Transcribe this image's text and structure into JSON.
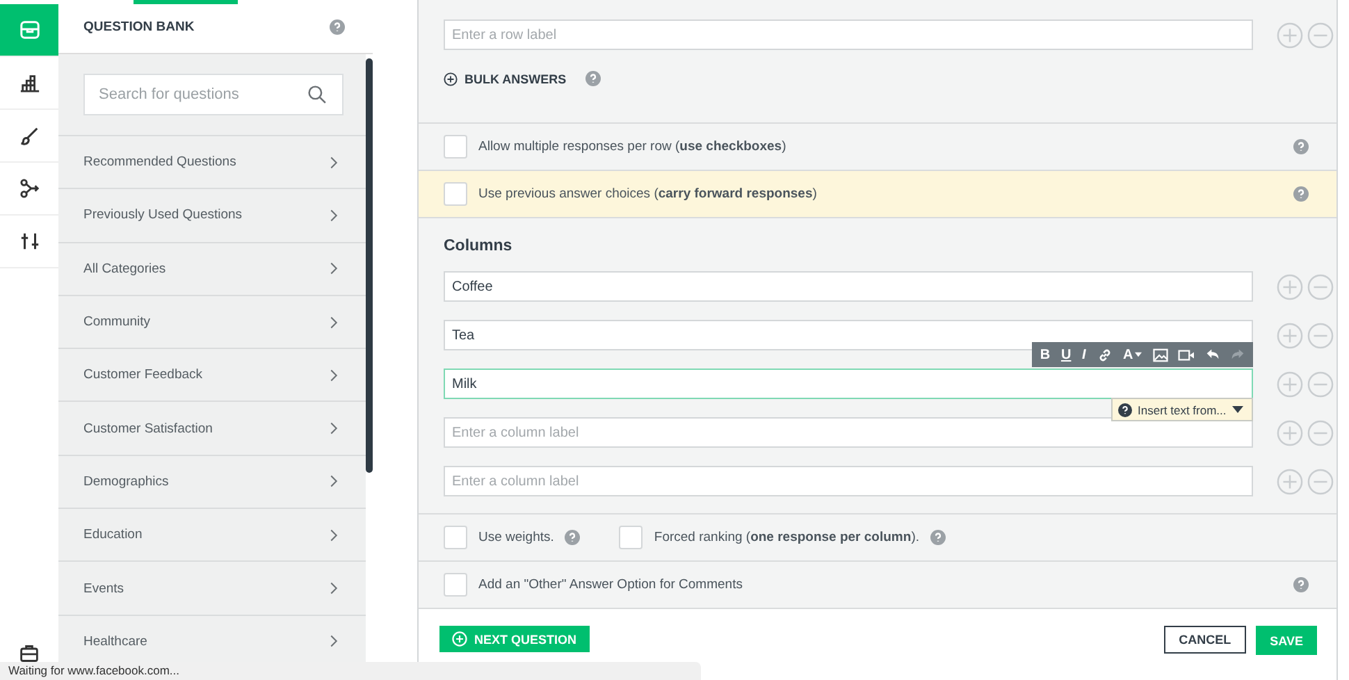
{
  "rail_items": [
    {
      "selected": true
    },
    {
      "selected": false
    },
    {
      "selected": false
    },
    {
      "selected": false
    },
    {
      "selected": false
    }
  ],
  "sidebar": {
    "title": "QUESTION BANK",
    "search": {
      "placeholder": "Search for questions"
    },
    "items": [
      "Recommended Questions",
      "Previously Used Questions",
      "All Categories",
      "Community",
      "Customer Feedback",
      "Customer Satisfaction",
      "Demographics",
      "Education",
      "Events",
      "Healthcare"
    ]
  },
  "rows_section": {
    "row_input": {
      "placeholder": "Enter a row label"
    },
    "bulk_answers": "BULK ANSWERS"
  },
  "options": [
    {
      "text": "Allow multiple responses per row (**use checkboxes**)",
      "checked": false,
      "highlighted": false
    },
    {
      "text": "Use previous answer choices (**carry forward responses**)",
      "checked": false,
      "highlighted": true
    }
  ],
  "columns": {
    "title": "Columns",
    "items": [
      {
        "value": "Coffee",
        "focused": false
      },
      {
        "value": "Tea",
        "focused": false
      },
      {
        "value": "Milk",
        "focused": true
      },
      {
        "placeholder": "Enter a column label",
        "focused": false
      },
      {
        "placeholder": "Enter a column label",
        "focused": false
      }
    ]
  },
  "editor_toolbar": [
    {
      "kind": "bold",
      "label": "B",
      "disabled": false
    },
    {
      "kind": "underline",
      "label": "U",
      "disabled": false
    },
    {
      "kind": "italic",
      "label": "I",
      "disabled": false
    },
    {
      "kind": "link",
      "disabled": false
    },
    {
      "kind": "color",
      "label": "A",
      "disabled": false
    },
    {
      "kind": "image",
      "disabled": false
    },
    {
      "kind": "video",
      "disabled": false
    },
    {
      "kind": "undo",
      "disabled": false
    },
    {
      "kind": "redo",
      "disabled": true
    }
  ],
  "insert_menu": {
    "label": "Insert text from..."
  },
  "settings_row": [
    {
      "text": "Use weights.",
      "checked": false
    },
    {
      "text": "Forced ranking (**one response per column**).",
      "checked": false
    }
  ],
  "other_option": {
    "text": "Add an \"Other\" Answer Option for Comments",
    "checked": false
  },
  "footer": {
    "next": "NEXT QUESTION",
    "cancel": "CANCEL",
    "save": "SAVE"
  },
  "status_bar": "Waiting for www.facebook.com..."
}
